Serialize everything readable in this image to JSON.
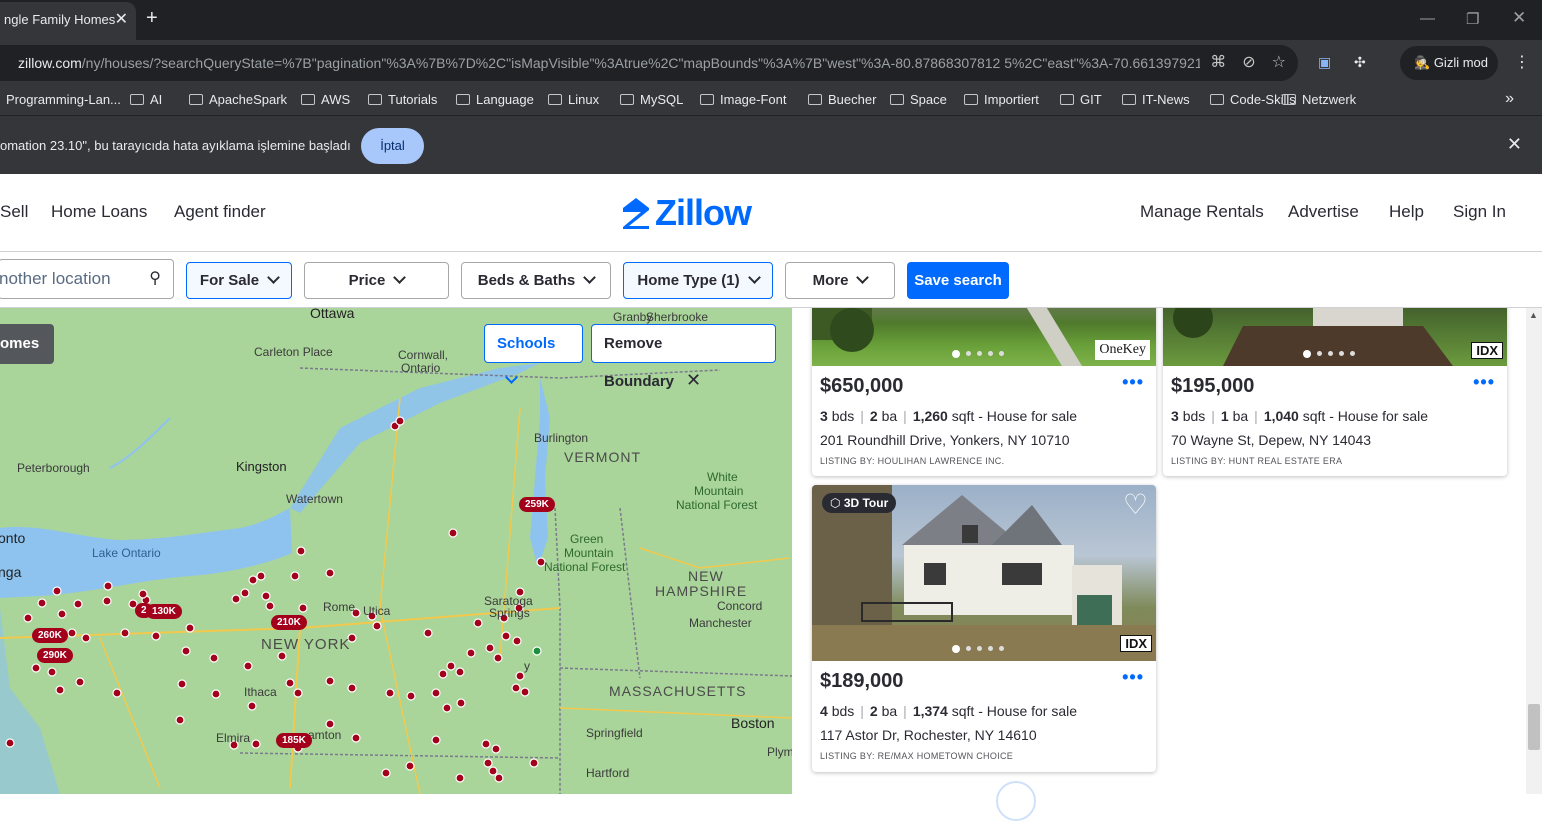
{
  "browser": {
    "tab_title": "ngle Family Homes",
    "url_host": "zillow.com",
    "url_rest": "/ny/houses/?searchQueryState=%7B\"pagination\"%3A%7B%7D%2C\"isMapVisible\"%3Atrue%2C\"mapBounds\"%3A%7B\"west\"%3A-80.87868307812 5%2C\"east\"%3A-70.6613979218...",
    "incognito_label": "Gizli mod",
    "bookmarks": [
      "Programming-Lan...",
      "AI",
      "ApacheSpark",
      "AWS",
      "Tutorials",
      "Language",
      "Linux",
      "MySQL",
      "Image-Font",
      "Buecher",
      "Space",
      "Importiert",
      "GIT",
      "IT-News",
      "Code-Skills",
      "Netzwerk"
    ],
    "infobar_message": "omation 23.10\", bu tarayıcıda hata ayıklama işlemine başladı",
    "infobar_cancel": "İptal"
  },
  "header": {
    "nav_left": [
      "Sell",
      "Home Loans",
      "Agent finder"
    ],
    "logo_text": "Zillow",
    "nav_right": [
      "Manage Rentals",
      "Advertise",
      "Help",
      "Sign In"
    ]
  },
  "filters": {
    "search_value": "nother location",
    "for_sale": "For Sale",
    "price": "Price",
    "beds_baths": "Beds & Baths",
    "home_type": "Home Type (1)",
    "more": "More",
    "save_search": "Save search"
  },
  "map": {
    "homes_label": "omes",
    "schools_label": "Schools",
    "remove_boundary_label": "Remove Boundary",
    "places": {
      "ottawa": "Ottawa",
      "granby": "Granby",
      "sherbrooke": "Sherbrooke",
      "carleton": "Carleton Place",
      "cornwall": "Cornwall,",
      "ontario": "Ontario",
      "burlington": "Burlington",
      "vermont": "VERMONT",
      "kingston": "Kingston",
      "peterborough": "Peterborough",
      "watertown": "Watertown",
      "white_mtn_1": "White",
      "white_mtn_2": "Mountain",
      "white_mtn_3": "National Forest",
      "onto": "onto",
      "lake_ontario": "Lake Ontario",
      "green_mtn_1": "Green",
      "green_mtn_2": "Mountain",
      "green_mtn_3": "National Forest",
      "new_hamp_1": "NEW",
      "new_hamp_2": "HAMPSHIRE",
      "concord": "Concord",
      "saratoga": "Saratoga",
      "springs": "Springs",
      "rome": "Rome",
      "utica": "Utica",
      "manchester": "Manchester",
      "new_york": "NEW YORK",
      "nga": "nga",
      "ithaca": "Ithaca",
      "mass": "MASSACHUSETTS",
      "elmira": "Elmira",
      "binghamton": "amton",
      "springfield": "Springfield",
      "boston": "Boston",
      "hartford": "Hartford",
      "plym": "Plym",
      "albany": "y"
    },
    "price_pins": [
      "259K",
      "130K",
      "210K",
      "260K",
      "290K",
      "185K",
      "2"
    ]
  },
  "listings": [
    {
      "price": "$650,000",
      "beds": "3",
      "beds_unit": "bds",
      "baths": "2",
      "baths_unit": "ba",
      "sqft": "1,260",
      "sqft_unit": "sqft",
      "type": "- House for sale",
      "address": "201 Roundhill Drive, Yonkers, NY 10710",
      "listing_by": "LISTING BY: HOULIHAN LAWRENCE INC.",
      "badge": "OneKey"
    },
    {
      "price": "$195,000",
      "beds": "3",
      "beds_unit": "bds",
      "baths": "1",
      "baths_unit": "ba",
      "sqft": "1,040",
      "sqft_unit": "sqft",
      "type": "- House for sale",
      "address": "70 Wayne St, Depew, NY 14043",
      "listing_by": "LISTING BY: HUNT REAL ESTATE ERA",
      "badge": "IDX"
    },
    {
      "price": "$189,000",
      "beds": "4",
      "beds_unit": "bds",
      "baths": "2",
      "baths_unit": "ba",
      "sqft": "1,374",
      "sqft_unit": "sqft",
      "type": "- House for sale",
      "address": "117 Astor Dr, Rochester, NY 14610",
      "listing_by": "LISTING BY: RE/MAX HOMETOWN CHOICE",
      "badge": "IDX",
      "tour_label": "3D Tour"
    }
  ],
  "colors": {
    "brand_blue": "#006aff",
    "pin_red": "#a3001b",
    "map_green": "#a9d49a",
    "water": "#8ec3f0"
  }
}
